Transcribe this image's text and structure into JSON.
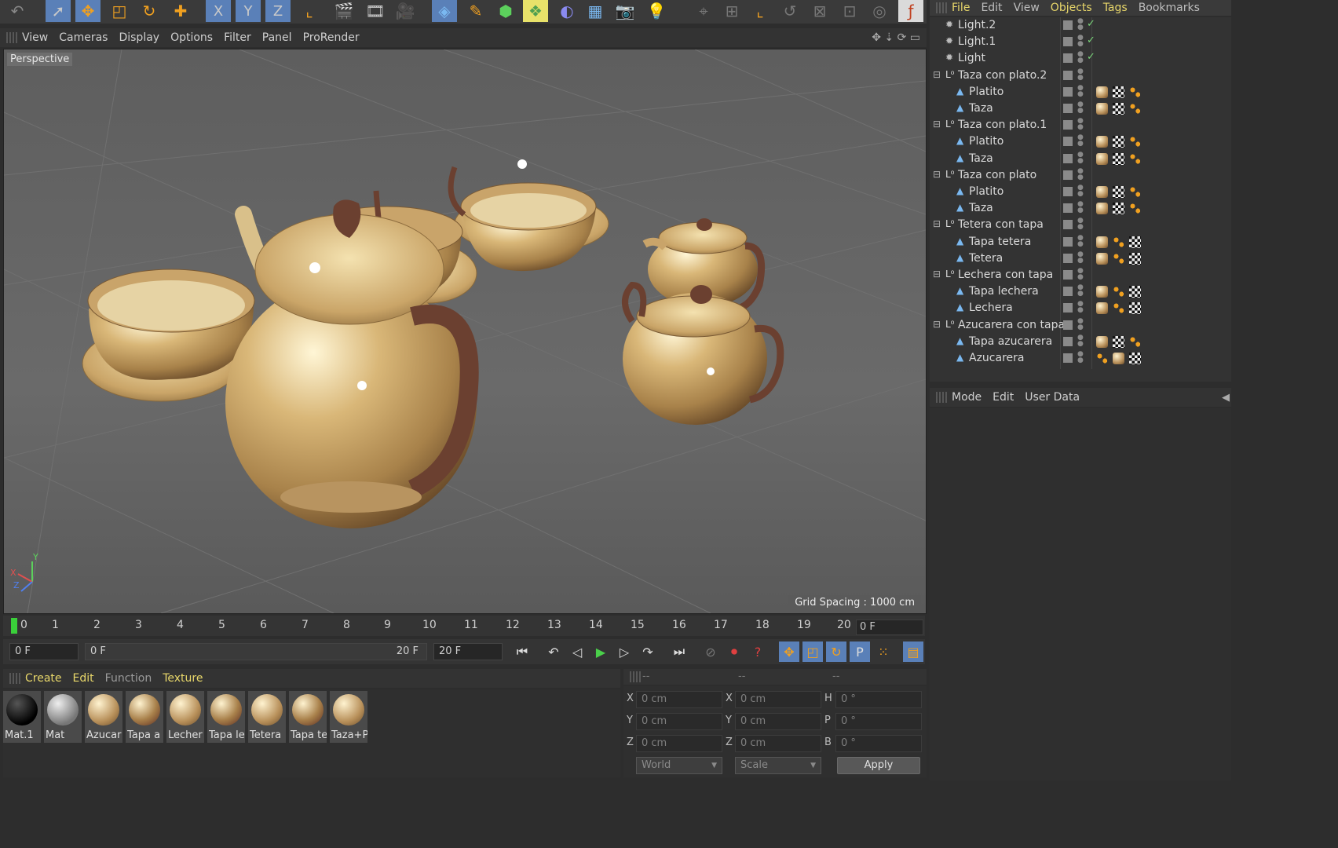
{
  "toolbar": {
    "icons": [
      "undo-icon",
      "select-cursor-icon",
      "move-icon",
      "scale-icon",
      "rotate-icon",
      "add-icon",
      "x-axis-icon",
      "y-axis-icon",
      "z-axis-icon",
      "coordinate-system-icon",
      "render-view-icon",
      "render-picture-viewer-icon",
      "render-settings-icon",
      "cube-icon",
      "pen-icon",
      "subdivision-icon",
      "array-icon",
      "deformer-icon",
      "floor-icon",
      "camera-icon",
      "light-icon"
    ],
    "axis_labels": [
      "X",
      "Y",
      "Z"
    ]
  },
  "viewport": {
    "menu": [
      "View",
      "Cameras",
      "Display",
      "Options",
      "Filter",
      "Panel",
      "ProRender"
    ],
    "camera_label": "Perspective",
    "grid_spacing": "Grid Spacing : 1000 cm",
    "axis_labels": [
      "Y",
      "X",
      "Z"
    ]
  },
  "timeline": {
    "ticks": [
      "0",
      "1",
      "2",
      "3",
      "4",
      "5",
      "6",
      "7",
      "8",
      "9",
      "10",
      "11",
      "12",
      "13",
      "14",
      "15",
      "16",
      "17",
      "18",
      "19",
      "20"
    ],
    "current_frame": "0 F"
  },
  "transport": {
    "start_frame": "0 F",
    "range_start": "0 F",
    "range_end": "20 F",
    "end_frame": "20 F"
  },
  "material_manager": {
    "menu": [
      "Create",
      "Edit",
      "Function",
      "Texture"
    ],
    "materials": [
      {
        "label": "Mat.1",
        "ball": "#0d0d0d"
      },
      {
        "label": "Mat",
        "ball": "#9c9c9c"
      },
      {
        "label": "Azucar",
        "ball": "#c9a46a"
      },
      {
        "label": "Tapa a",
        "ball": "#b88a5a"
      },
      {
        "label": "Lecher",
        "ball": "#c9a46a"
      },
      {
        "label": "Tapa le",
        "ball": "#b88a5a"
      },
      {
        "label": "Tetera",
        "ball": "#c9a46a"
      },
      {
        "label": "Tapa te",
        "ball": "#b88a5a"
      },
      {
        "label": "Taza+P",
        "ball": "#c9a46a"
      }
    ]
  },
  "coordinates": {
    "headers": [
      "--",
      "--",
      "--"
    ],
    "rows": [
      {
        "a": "X",
        "av": "0 cm",
        "b": "X",
        "bv": "0 cm",
        "c": "H",
        "cv": "0 °"
      },
      {
        "a": "Y",
        "av": "0 cm",
        "b": "Y",
        "bv": "0 cm",
        "c": "P",
        "cv": "0 °"
      },
      {
        "a": "Z",
        "av": "0 cm",
        "b": "Z",
        "bv": "0 cm",
        "c": "B",
        "cv": "0 °"
      }
    ],
    "mode_select": "World",
    "size_select": "Scale",
    "apply_label": "Apply"
  },
  "object_manager": {
    "menu": [
      "File",
      "Edit",
      "View",
      "Objects",
      "Tags",
      "Bookmarks"
    ],
    "active_menu": "Objects",
    "objects": [
      {
        "name": "Light.2",
        "level": 0,
        "type": "light",
        "check": "✓",
        "tags": []
      },
      {
        "name": "Light.1",
        "level": 0,
        "type": "light",
        "check": "✓",
        "tags": []
      },
      {
        "name": "Light",
        "level": 0,
        "type": "light",
        "check": "✓",
        "tags": []
      },
      {
        "name": "Taza con plato.2",
        "level": 0,
        "type": "null",
        "check": "",
        "tags": []
      },
      {
        "name": "Platito",
        "level": 1,
        "type": "poly",
        "check": "",
        "tags": [
          "mat",
          "tex",
          "uv"
        ]
      },
      {
        "name": "Taza",
        "level": 1,
        "type": "poly",
        "check": "",
        "tags": [
          "mat",
          "tex",
          "uv"
        ]
      },
      {
        "name": "Taza con plato.1",
        "level": 0,
        "type": "null",
        "check": "",
        "tags": []
      },
      {
        "name": "Platito",
        "level": 1,
        "type": "poly",
        "check": "",
        "tags": [
          "mat",
          "tex",
          "uv"
        ]
      },
      {
        "name": "Taza",
        "level": 1,
        "type": "poly",
        "check": "",
        "tags": [
          "mat",
          "tex",
          "uv"
        ]
      },
      {
        "name": "Taza con plato",
        "level": 0,
        "type": "null",
        "check": "",
        "tags": []
      },
      {
        "name": "Platito",
        "level": 1,
        "type": "poly",
        "check": "",
        "tags": [
          "mat",
          "tex",
          "uv"
        ]
      },
      {
        "name": "Taza",
        "level": 1,
        "type": "poly",
        "check": "",
        "tags": [
          "mat",
          "tex",
          "uv"
        ]
      },
      {
        "name": "Tetera con tapa",
        "level": 0,
        "type": "null",
        "check": "",
        "tags": []
      },
      {
        "name": "Tapa tetera",
        "level": 1,
        "type": "poly",
        "check": "",
        "tags": [
          "mat",
          "uv",
          "tex"
        ]
      },
      {
        "name": "Tetera",
        "level": 1,
        "type": "poly",
        "check": "",
        "tags": [
          "mat",
          "uv",
          "tex"
        ]
      },
      {
        "name": "Lechera con tapa",
        "level": 0,
        "type": "null",
        "check": "",
        "tags": []
      },
      {
        "name": "Tapa lechera",
        "level": 1,
        "type": "poly",
        "check": "",
        "tags": [
          "mat",
          "uv",
          "tex"
        ]
      },
      {
        "name": "Lechera",
        "level": 1,
        "type": "poly",
        "check": "",
        "tags": [
          "mat",
          "uv",
          "tex"
        ]
      },
      {
        "name": "Azucarera con tapa",
        "level": 0,
        "type": "null",
        "check": "",
        "tags": []
      },
      {
        "name": "Tapa azucarera",
        "level": 1,
        "type": "poly",
        "check": "",
        "tags": [
          "mat",
          "tex",
          "uv"
        ]
      },
      {
        "name": "Azucarera",
        "level": 1,
        "type": "poly",
        "check": "",
        "tags": [
          "uv",
          "mat",
          "tex"
        ]
      }
    ]
  },
  "attributes": {
    "menu": [
      "Mode",
      "Edit",
      "User Data"
    ]
  },
  "colors": {
    "accent_yellow": "#e8d76a",
    "selection_blue": "#5a80b8",
    "check_green": "#7ad47a",
    "viewport_bg": "#626262"
  }
}
